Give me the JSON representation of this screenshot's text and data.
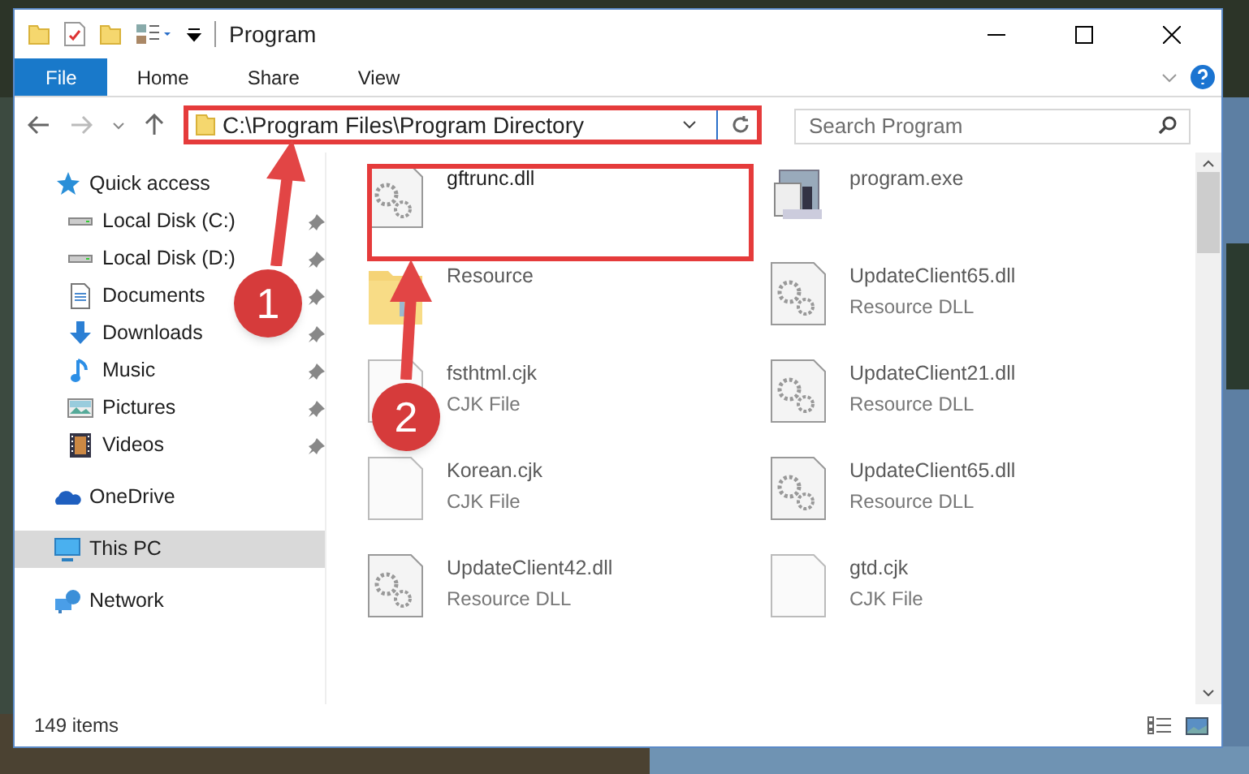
{
  "window": {
    "title": "Program"
  },
  "ribbon_tabs": [
    {
      "label": "File",
      "selected": true
    },
    {
      "label": "Home",
      "selected": false
    },
    {
      "label": "Share",
      "selected": false
    },
    {
      "label": "View",
      "selected": false
    }
  ],
  "address": {
    "path": "C:\\Program Files\\Program Directory"
  },
  "search": {
    "placeholder": "Search Program"
  },
  "sidebar": {
    "items": [
      {
        "label": "Quick access",
        "kind": "star",
        "selected": false,
        "children": [
          {
            "label": "Local Disk (C:)",
            "kind": "disk",
            "pinned": true
          },
          {
            "label": "Local Disk (D:)",
            "kind": "disk",
            "pinned": true
          },
          {
            "label": "Documents",
            "kind": "doc",
            "pinned": true
          },
          {
            "label": "Downloads",
            "kind": "download",
            "pinned": true
          },
          {
            "label": "Music",
            "kind": "music",
            "pinned": true
          },
          {
            "label": "Pictures",
            "kind": "pictures",
            "pinned": true
          },
          {
            "label": "Videos",
            "kind": "video",
            "pinned": true
          }
        ]
      },
      {
        "label": "OneDrive",
        "kind": "cloud",
        "selected": false
      },
      {
        "label": "This PC",
        "kind": "pc",
        "selected": true
      },
      {
        "label": "Network",
        "kind": "network",
        "selected": false
      }
    ]
  },
  "files": [
    {
      "name": "gftrunc.dll",
      "kind": "dll",
      "highlighted": true
    },
    {
      "name": "program.exe",
      "kind": "exe",
      "highlighted": false
    },
    {
      "name": "Resource",
      "kind": "folder",
      "highlighted": false
    },
    {
      "name": "UpdateClient65.dll",
      "type": "Resource DLL",
      "kind": "dll",
      "highlighted": false
    },
    {
      "name": "fsthtml.cjk",
      "type": "CJK File",
      "kind": "file",
      "highlighted": false
    },
    {
      "name": "UpdateClient21.dll",
      "type": "Resource DLL",
      "kind": "dll",
      "highlighted": false
    },
    {
      "name": "Korean.cjk",
      "type": "CJK File",
      "kind": "file",
      "highlighted": false
    },
    {
      "name": "UpdateClient65.dll",
      "type": "Resource DLL",
      "kind": "dll",
      "highlighted": false
    },
    {
      "name": "UpdateClient42.dll",
      "type": "Resource DLL",
      "kind": "dll",
      "highlighted": false
    },
    {
      "name": "gtd.cjk",
      "type": "CJK File",
      "kind": "file",
      "highlighted": false
    }
  ],
  "status_bar": {
    "count": "149 items"
  },
  "annotations": [
    {
      "label": "1"
    },
    {
      "label": "2"
    }
  ]
}
